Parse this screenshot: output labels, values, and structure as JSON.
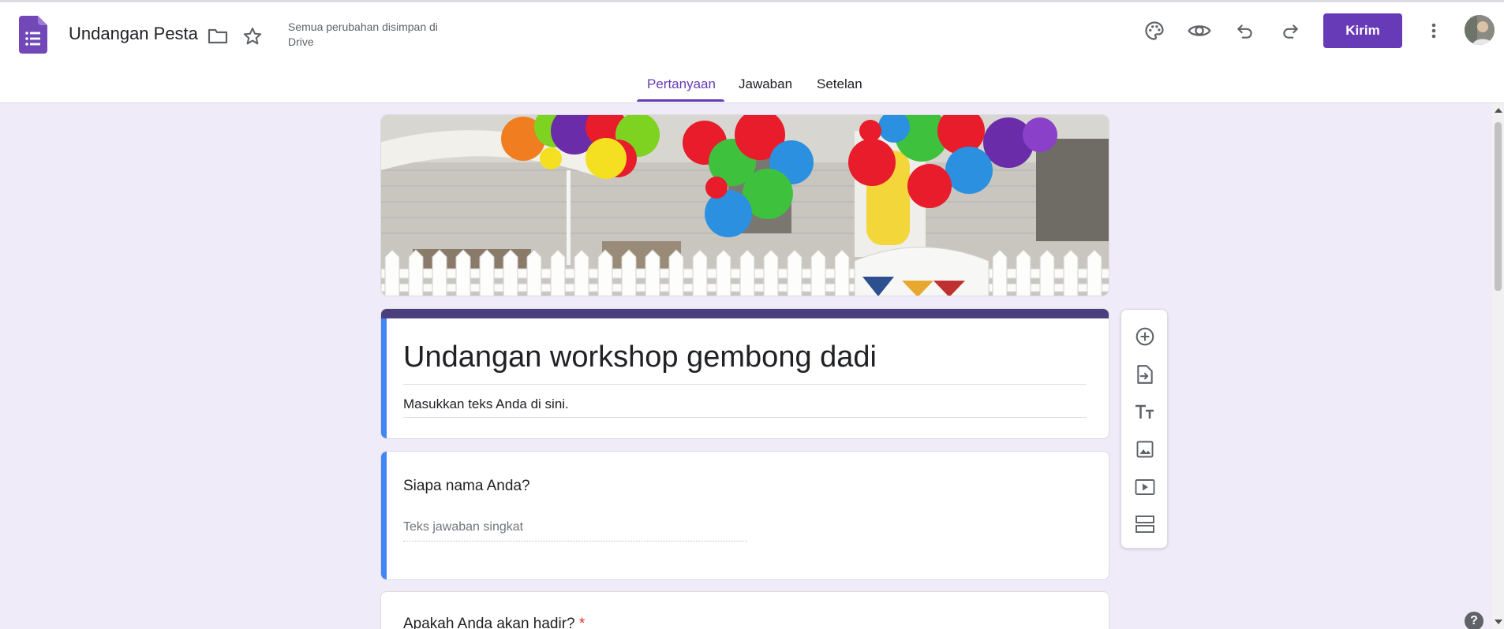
{
  "app": {
    "doc_title": "Undangan Pesta",
    "save_status": "Semua perubahan disimpan di Drive",
    "send_label": "Kirim",
    "accent_color": "#673ab7",
    "header_icons": [
      "forms-logo-icon",
      "folder-icon",
      "star-icon",
      "palette-icon",
      "preview-eye-icon",
      "undo-icon",
      "redo-icon",
      "more-vert-icon"
    ]
  },
  "tabs": [
    {
      "label": "Pertanyaan",
      "active": true
    },
    {
      "label": "Jawaban",
      "active": false
    },
    {
      "label": "Setelan",
      "active": false
    }
  ],
  "form": {
    "title": "Undangan workshop gembong dadi",
    "description": "Masukkan teks Anda di sini."
  },
  "questions": [
    {
      "title": "Siapa nama Anda?",
      "answer_placeholder": "Teks jawaban singkat",
      "required": false
    },
    {
      "title": "Apakah Anda akan hadir?",
      "required": true,
      "required_mark": "*"
    }
  ],
  "toolbar_icons": [
    "add-question-icon",
    "import-questions-icon",
    "add-title-icon",
    "add-image-icon",
    "add-video-icon",
    "add-section-icon"
  ],
  "help": {
    "label": "?"
  }
}
